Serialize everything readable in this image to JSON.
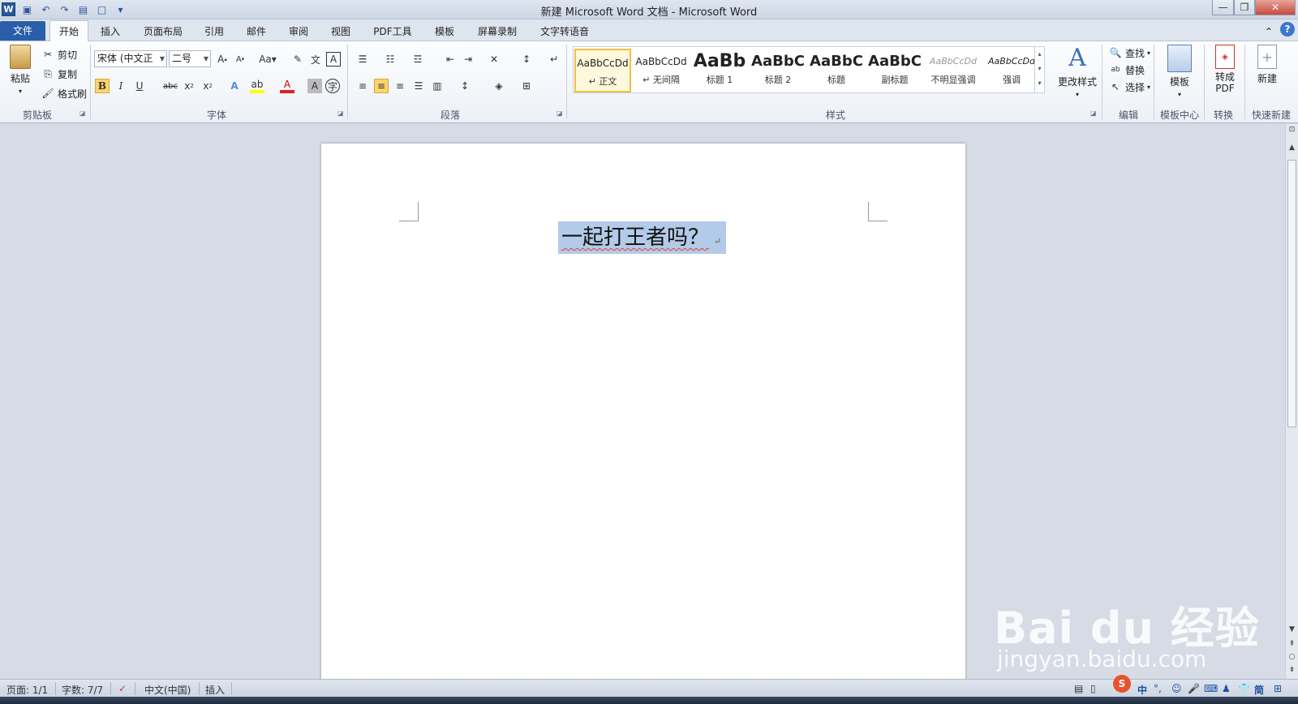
{
  "window": {
    "title": "新建 Microsoft Word 文档 - Microsoft Word"
  },
  "tabs": [
    {
      "label": "文件"
    },
    {
      "label": "开始"
    },
    {
      "label": "插入"
    },
    {
      "label": "页面布局"
    },
    {
      "label": "引用"
    },
    {
      "label": "邮件"
    },
    {
      "label": "审阅"
    },
    {
      "label": "视图"
    },
    {
      "label": "PDF工具"
    },
    {
      "label": "模板"
    },
    {
      "label": "屏幕录制"
    },
    {
      "label": "文字转语音"
    }
  ],
  "clipboard": {
    "paste": "粘贴",
    "cut": "剪切",
    "copy": "复制",
    "format_painter": "格式刷",
    "group": "剪贴板"
  },
  "font": {
    "name": "宋体 (中文正",
    "size": "二号",
    "group": "字体",
    "bold": "B",
    "italic": "I",
    "underline": "U"
  },
  "paragraph": {
    "group": "段落"
  },
  "styles": {
    "group": "样式",
    "items": [
      {
        "preview": "AaBbCcDd",
        "name": "↵ 正文"
      },
      {
        "preview": "AaBbCcDd",
        "name": "↵ 无间隔"
      },
      {
        "preview": "AaBb",
        "name": "标题 1"
      },
      {
        "preview": "AaBbC",
        "name": "标题 2"
      },
      {
        "preview": "AaBbC",
        "name": "标题"
      },
      {
        "preview": "AaBbC",
        "name": "副标题"
      },
      {
        "preview": "AaBbCcDd",
        "name": "不明显强调"
      },
      {
        "preview": "AaBbCcDd",
        "name": "强调"
      }
    ],
    "change_styles": "更改样式"
  },
  "editing": {
    "find": "查找",
    "replace": "替换",
    "select": "选择",
    "group": "编辑"
  },
  "template_center": {
    "template": "模板",
    "group": "模板中心"
  },
  "convert": {
    "to_pdf": "转成\nPDF",
    "group": "转换"
  },
  "quick_new": {
    "new": "新建",
    "group": "快速新建"
  },
  "document": {
    "text": "一起打王者吗？",
    "paragraph_mark": "↵"
  },
  "status": {
    "page": "页面: 1/1",
    "words": "字数: 7/7",
    "language": "中文(中国)",
    "mode": "插入"
  },
  "ime": {
    "chinese": "中"
  },
  "watermark": {
    "brand": "Bai du 经验",
    "url": "jingyan.baidu.com"
  },
  "colors": {
    "file_tab": "#2a5ea8",
    "selection": "#b3cbe9",
    "style_selected_border": "#f0c040"
  }
}
